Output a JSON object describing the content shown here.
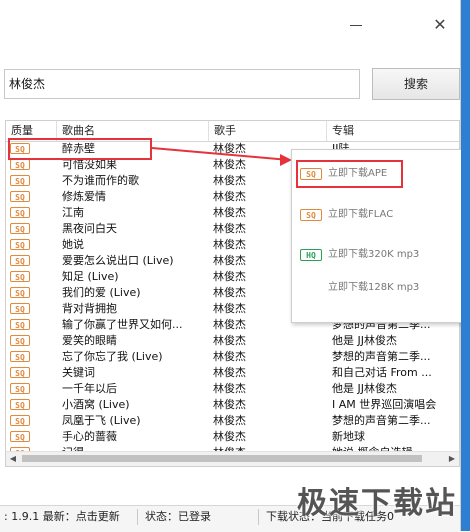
{
  "window": {
    "minimize_glyph": "",
    "close_glyph": "✕"
  },
  "search": {
    "value": "林俊杰",
    "button_label": "搜索"
  },
  "table": {
    "headers": [
      "质量",
      "歌曲名",
      "歌手",
      "专辑"
    ],
    "rows": [
      {
        "quality": "SQ",
        "name": "醉赤壁",
        "singer": "林俊杰",
        "album": "JJ陆"
      },
      {
        "quality": "SQ",
        "name": "可惜没如果",
        "singer": "林俊杰",
        "album": ""
      },
      {
        "quality": "SQ",
        "name": "不为谁而作的歌",
        "singer": "林俊杰",
        "album": ""
      },
      {
        "quality": "SQ",
        "name": "修炼爱情",
        "singer": "林俊杰",
        "album": ""
      },
      {
        "quality": "SQ",
        "name": "江南",
        "singer": "林俊杰",
        "album": ""
      },
      {
        "quality": "SQ",
        "name": "黑夜问白天",
        "singer": "林俊杰",
        "album": ""
      },
      {
        "quality": "SQ",
        "name": "她说",
        "singer": "林俊杰",
        "album": ""
      },
      {
        "quality": "SQ",
        "name": "爱要怎么说出口 (Live)",
        "singer": "林俊杰",
        "album": ""
      },
      {
        "quality": "SQ",
        "name": "知足 (Live)",
        "singer": "林俊杰",
        "album": ""
      },
      {
        "quality": "SQ",
        "name": "我们的爱 (Live)",
        "singer": "林俊杰",
        "album": ""
      },
      {
        "quality": "SQ",
        "name": "背对背拥抱",
        "singer": "林俊杰",
        "album": ""
      },
      {
        "quality": "SQ",
        "name": "输了你赢了世界又如何...",
        "singer": "林俊杰",
        "album": "梦想的声音第二季..."
      },
      {
        "quality": "SQ",
        "name": "爱笑的眼睛",
        "singer": "林俊杰",
        "album": "他是 JJ林俊杰"
      },
      {
        "quality": "SQ",
        "name": "忘了你忘了我 (Live)",
        "singer": "林俊杰",
        "album": "梦想的声音第二季..."
      },
      {
        "quality": "SQ",
        "name": "关键词",
        "singer": "林俊杰",
        "album": "和自己对话 From ..."
      },
      {
        "quality": "SQ",
        "name": "一千年以后",
        "singer": "林俊杰",
        "album": "他是 JJ林俊杰"
      },
      {
        "quality": "SQ",
        "name": "小酒窝 (Live)",
        "singer": "林俊杰",
        "album": "I AM 世界巡回演唱会"
      },
      {
        "quality": "SQ",
        "name": "凤凰于飞 (Live)",
        "singer": "林俊杰",
        "album": "梦想的声音第二季..."
      },
      {
        "quality": "SQ",
        "name": "手心的蔷薇",
        "singer": "林俊杰",
        "album": "新地球"
      },
      {
        "quality": "SQ",
        "name": "记得",
        "singer": "林俊杰",
        "album": "她说 概念自选辑"
      }
    ]
  },
  "popup": {
    "items": [
      {
        "badge": "SQ",
        "label": "立即下载APE",
        "badge_type": "sq"
      },
      {
        "badge": "SQ",
        "label": "立即下载FLAC",
        "badge_type": "sq"
      },
      {
        "badge": "HQ",
        "label": "立即下载320K mp3",
        "badge_type": "hq"
      },
      {
        "badge": "",
        "label": "立即下载128K mp3",
        "badge_type": "none"
      }
    ]
  },
  "status": {
    "version": ": 1.9.1 最新：点击更新",
    "login": "状态：已登录",
    "download": "下载状态：当前下载任务0"
  },
  "watermark": "极速下载站",
  "colors": {
    "accent_red": "#e5333b",
    "sq_orange": "#e08a3c",
    "hq_green": "#29a05a",
    "edge_blue": "#2d7fd1"
  }
}
